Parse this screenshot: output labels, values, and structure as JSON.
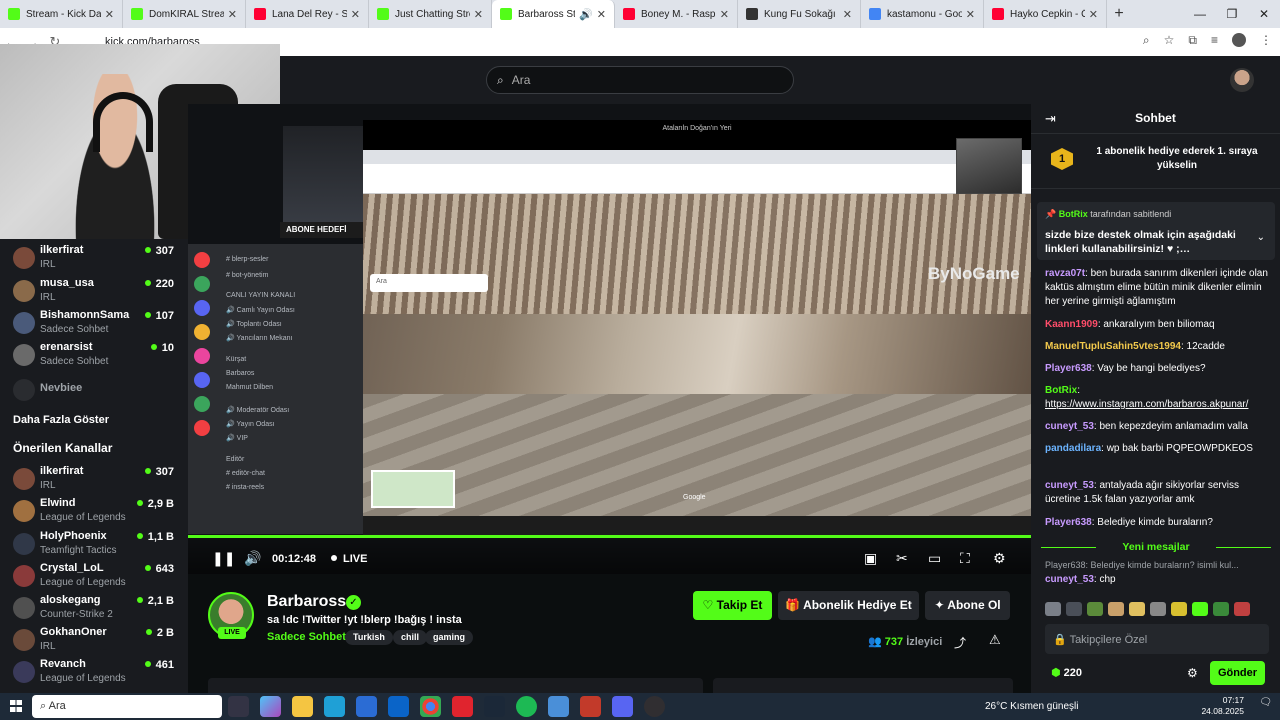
{
  "browser": {
    "tabs": [
      {
        "label": "Stream - Kick Dashbo",
        "color": "#53fc18",
        "active": false
      },
      {
        "label": "DomKIRAL Stream - Y",
        "color": "#53fc18",
        "active": false
      },
      {
        "label": "Lana Del Rey - Summ",
        "color": "#ff0033",
        "active": false
      },
      {
        "label": "Just Chatting Stream",
        "color": "#53fc18",
        "active": false
      },
      {
        "label": "Barbaross Stream",
        "color": "#53fc18",
        "active": true
      },
      {
        "label": "Boney M. - Rasputin",
        "color": "#ff0033",
        "active": false
      },
      {
        "label": "Kung Fu Sokağı izle",
        "color": "#333333",
        "active": false
      },
      {
        "label": "kastamonu - Google",
        "color": "#4285f4",
        "active": false
      },
      {
        "label": "Hayko Cepkin - Ölüy",
        "color": "#ff0033",
        "active": false
      }
    ],
    "new_tab": "+",
    "url": "kick.com/barbaross",
    "window_controls": [
      "—",
      "❐",
      "✕"
    ]
  },
  "header": {
    "search_placeholder": "Ara"
  },
  "sidebar": {
    "channels": [
      {
        "name": "ilkerfirat",
        "sub": "IRL",
        "viewers": "307",
        "color": "#7a4a3a"
      },
      {
        "name": "musa_usa",
        "sub": "IRL",
        "viewers": "220",
        "color": "#8a6a4a"
      },
      {
        "name": "BishamonnSama",
        "sub": "Sadece Sohbet",
        "viewers": "107",
        "color": "#4a5a7a"
      },
      {
        "name": "erenarsist",
        "sub": "Sadece Sohbet",
        "viewers": "10",
        "color": "#6a6a6a"
      },
      {
        "name": "Nevbiee",
        "sub": "",
        "viewers": "",
        "color": "#2a2c30"
      }
    ],
    "show_more": "Daha Fazla Göster",
    "recommended_heading": "Önerilen Kanallar",
    "recommended": [
      {
        "name": "ilkerfirat",
        "sub": "IRL",
        "viewers": "307",
        "color": "#7a4a3a"
      },
      {
        "name": "Elwind",
        "sub": "League of Legends",
        "viewers": "2,9 B",
        "color": "#a07040"
      },
      {
        "name": "HolyPhoenix",
        "sub": "Teamfight Tactics",
        "viewers": "1,1 B",
        "color": "#303848"
      },
      {
        "name": "Crystal_LoL",
        "sub": "League of Legends",
        "viewers": "643",
        "color": "#8a3a3a"
      },
      {
        "name": "aloskegang",
        "sub": "Counter-Strike 2",
        "viewers": "2,1 B",
        "color": "#505050"
      },
      {
        "name": "GokhanOner",
        "sub": "IRL",
        "viewers": "2 B",
        "color": "#6a4a3a"
      },
      {
        "name": "Revanch",
        "sub": "League of Legends",
        "viewers": "461",
        "color": "#3a3a5a"
      }
    ]
  },
  "player": {
    "overlay": {
      "abone_hedefi": "ABONE HEDEFİ",
      "brand": "ByNoGame",
      "sv_search": "Ara",
      "sv_title": "Atalarıln Doğan'ın Yeri",
      "maps_label": "Google"
    },
    "progress": 1.0,
    "time": "00:12:48",
    "live_label": "LIVE"
  },
  "stream_info": {
    "channel_name": "Barbaross",
    "live_tag": "LIVE",
    "title": "sa   !dc !Twitter !yt !blerp !bağış ! insta",
    "category": "Sadece Sohbet",
    "tags": [
      "Turkish",
      "chill",
      "gaming"
    ],
    "follow_label": "Takip Et",
    "gift_label": "Abonelik Hediye Et",
    "sub_label": "Abone Ol",
    "viewer_count": "737",
    "viewer_label": "İzleyici"
  },
  "chat": {
    "title": "Sohbet",
    "gift_banner": "1 abonelik hediye ederek 1. sıraya yükselin",
    "gift_rank": "1",
    "pinned_by": "BotRix",
    "pinned_by_suffix": "tarafından sabitlendi",
    "pinned_text": "sizde bize destek olmak için aşağıdaki linkleri kullanabilirsiniz! ♥ ;…",
    "messages": [
      {
        "user": "ravza07t",
        "color": "#c89bff",
        "text": "ben burada sanırım dikenleri içinde olan kaktüs almıştım elime bütün minik dikenler elimin her yerine girmişti ağlamıştım"
      },
      {
        "user": "Kaann1909",
        "color": "#ff4d6a",
        "text": "ankaralıyım ben biliomaq"
      },
      {
        "user": "ManuelTupluSahin5vtes1994",
        "color": "#f2c94c",
        "text": "12cadde"
      },
      {
        "user": "Player638",
        "color": "#c89bff",
        "text": "Vay be hangi belediyes?"
      },
      {
        "user": "BotRix",
        "color": "#53fc18",
        "text": "https://www.instagram.com/barbaros.akpunar/"
      },
      {
        "user": "cuneyt_53",
        "color": "#c89bff",
        "text": "ben kepezdeyim anlamadım valla"
      },
      {
        "user": "pandadilara",
        "color": "#6cb4ff",
        "text": "wp bak barbi PQPEOWPDKEOS"
      },
      {
        "user": "cuneyt_53",
        "color": "#c89bff",
        "text": "antalyada ağır sikiyorlar serviss ücretine 1.5k falan yazıyorlar amk"
      },
      {
        "user": "Player638",
        "color": "#c89bff",
        "text": "Belediye kimde buraların?"
      }
    ],
    "new_messages_label": "Yeni mesajlar",
    "reply_preview": "Player638: Belediye kimde buraların? isimli kul...",
    "last_message": {
      "user": "cuneyt_53",
      "color": "#c89bff",
      "text": "chp"
    },
    "input_placeholder": "Takipçilere Özel",
    "points": "220",
    "send_label": "Gönder"
  },
  "taskbar": {
    "search_placeholder": "Ara",
    "weather": "26°C  Kısmen güneşli",
    "time": "07:17",
    "date": "24.08.2025"
  }
}
